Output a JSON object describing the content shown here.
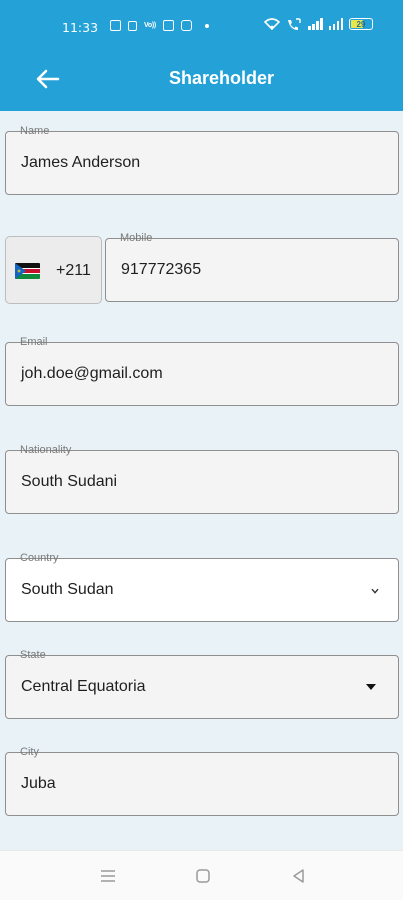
{
  "status_bar": {
    "time": "11:33",
    "volte_text": "Vo))",
    "battery_level": "29"
  },
  "header": {
    "title": "Shareholder",
    "back_icon": "arrow-left-icon"
  },
  "form": {
    "name": {
      "label": "Name",
      "value": "James Anderson"
    },
    "phone": {
      "flag": "south-sudan-flag-icon",
      "country_code": "+211",
      "label": "Mobile",
      "value": "917772365"
    },
    "email": {
      "label": "Email",
      "value": "joh.doe@gmail.com"
    },
    "nationality": {
      "label": "Nationality",
      "value": "South Sudani"
    },
    "country": {
      "label": "Country",
      "value": "South Sudan",
      "icon": "chevron-down-icon"
    },
    "state": {
      "label": "State",
      "value": "Central Equatoria",
      "icon": "dropdown-triangle-icon"
    },
    "city": {
      "label": "City",
      "value": "Juba"
    }
  },
  "nav_bar": [
    "menu-icon",
    "home-square-icon",
    "back-triangle-icon"
  ],
  "colors": {
    "header": "#24a1d6",
    "background": "#e9f2f6",
    "field_bg": "#f4f4f4",
    "field_border": "#8f8f8f"
  }
}
